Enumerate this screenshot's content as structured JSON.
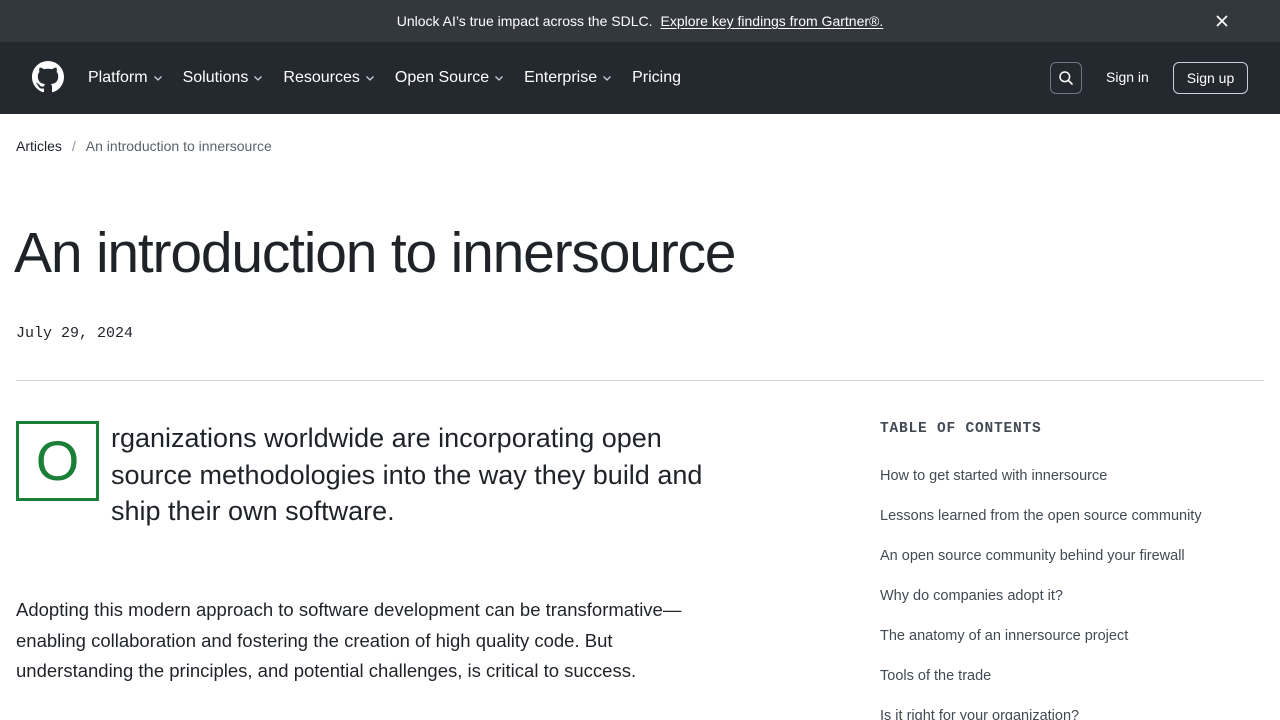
{
  "banner": {
    "text": "Unlock AI’s true impact across the SDLC.",
    "link": "Explore key findings from Gartner®."
  },
  "header": {
    "nav": [
      {
        "label": "Platform"
      },
      {
        "label": "Solutions"
      },
      {
        "label": "Resources"
      },
      {
        "label": "Open Source"
      },
      {
        "label": "Enterprise"
      },
      {
        "label": "Pricing"
      }
    ],
    "sign_in": "Sign in",
    "sign_up": "Sign up"
  },
  "breadcrumb": {
    "parent": "Articles",
    "separator": "/",
    "current": "An introduction to innersource"
  },
  "article": {
    "title": "An introduction to innersource",
    "date": "July 29, 2024",
    "dropcap": "O",
    "lead": "rganizations worldwide are incorporating open source methodologies into the way they build and ship their own software.",
    "paragraph": "Adopting this modern approach to software development can be transformative—enabling collaboration and fostering the creation of high quality code. But understanding the principles, and potential challenges, is critical to success."
  },
  "toc": {
    "heading": "TABLE OF CONTENTS",
    "items": [
      "How to get started with innersource",
      "Lessons learned from the open source community",
      "An open source community behind your firewall",
      "Why do companies adopt it?",
      "The anatomy of an innersource project",
      "Tools of the trade",
      "Is it right for your organization?"
    ]
  },
  "colors": {
    "banner_bg": "#33373e",
    "header_bg": "#24292f",
    "accent_green": "#1a7f37",
    "text": "#1f2328"
  },
  "icons": {
    "logo": "github-logo-icon",
    "close": "close-icon",
    "search": "search-icon",
    "chevron": "chevron-down-icon"
  }
}
